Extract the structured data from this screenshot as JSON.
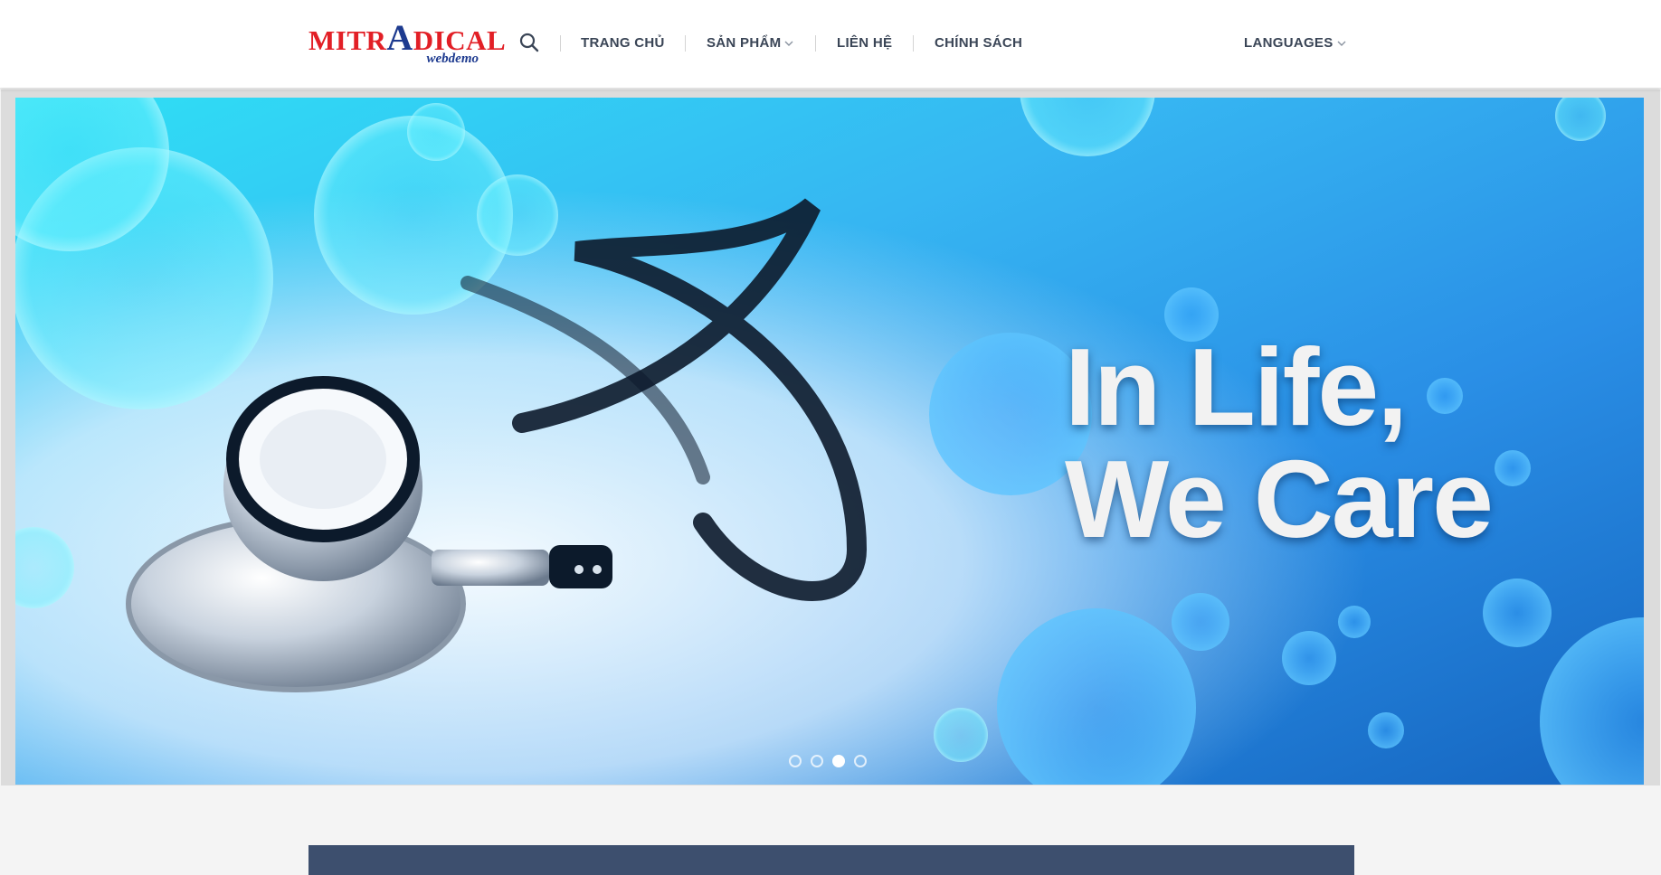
{
  "logo": {
    "main_left": "MITR",
    "main_mid": "A",
    "main_right": "DICAL",
    "sub": "webdemo"
  },
  "nav": {
    "search_icon": "search-icon",
    "items": [
      {
        "label": "TRANG CHỦ",
        "has_dropdown": false
      },
      {
        "label": "SẢN PHẨM",
        "has_dropdown": true
      },
      {
        "label": "LIÊN HỆ",
        "has_dropdown": false
      },
      {
        "label": "CHÍNH SÁCH",
        "has_dropdown": false
      }
    ],
    "languages": {
      "label": "LANGUAGES",
      "has_dropdown": true
    }
  },
  "hero": {
    "headline_line1": "In Life,",
    "headline_line2": "We Care",
    "slides_total": 4,
    "active_slide": 3
  },
  "colors": {
    "nav_text": "#3a4556",
    "logo_red": "#e21f26",
    "logo_blue": "#1d3a8f",
    "banner_blue": "#1e88e5",
    "content_bar": "#3d4f6e"
  }
}
